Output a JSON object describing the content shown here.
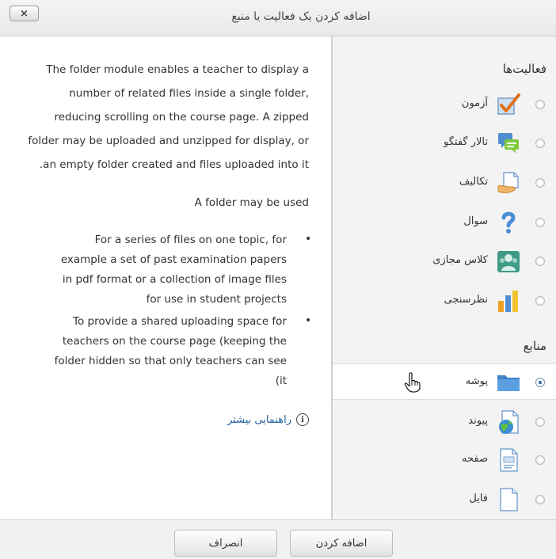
{
  "dialog": {
    "title": "اضافه کردن یک فعالیت یا منبع",
    "close_label": "×"
  },
  "chooser": {
    "activities_title": "فعالیت‌ها",
    "activities": [
      {
        "label": "آزمون",
        "icon": "quiz-icon"
      },
      {
        "label": "تالار گفتگو",
        "icon": "forum-icon"
      },
      {
        "label": "تکالیف",
        "icon": "assignment-icon"
      },
      {
        "label": "سوال",
        "icon": "question-icon"
      },
      {
        "label": "کلاس مجازی",
        "icon": "virtual-class-icon"
      },
      {
        "label": "نظرسنجی",
        "icon": "poll-icon"
      }
    ],
    "resources_title": "منابع",
    "resources": [
      {
        "label": "پوشه",
        "icon": "folder-icon",
        "selected": true
      },
      {
        "label": "پیوند",
        "icon": "url-icon"
      },
      {
        "label": "صفحه",
        "icon": "page-icon"
      },
      {
        "label": "فایل",
        "icon": "file-icon"
      }
    ]
  },
  "help": {
    "intro_lines": [
      "The folder module enables a teacher to display a",
      "number of related files inside a single folder,",
      "reducing scrolling on the course page. A zipped",
      "folder may be uploaded and unzipped for display, or",
      ".an empty folder created and files uploaded into it"
    ],
    "used_title": "A folder may be used",
    "bullet1_lines": [
      "For a series of files on one topic, for",
      "example a set of past examination papers",
      "in pdf format or a collection of image files",
      "for use in student projects"
    ],
    "bullet2_lines": [
      "To provide a shared uploading space for",
      "teachers on the course page (keeping the",
      "folder hidden so that only teachers can see",
      "(it"
    ],
    "bullet_char": "•",
    "more_help_label": "راهنمایی بیشتر",
    "info_icon_glyph": "i"
  },
  "footer": {
    "add_label": "اضافه کردن",
    "cancel_label": "انصراف"
  },
  "colors": {
    "link": "#1f5fa0",
    "panel_bg": "#f3f3f3",
    "selected_bg": "#ffffff"
  }
}
